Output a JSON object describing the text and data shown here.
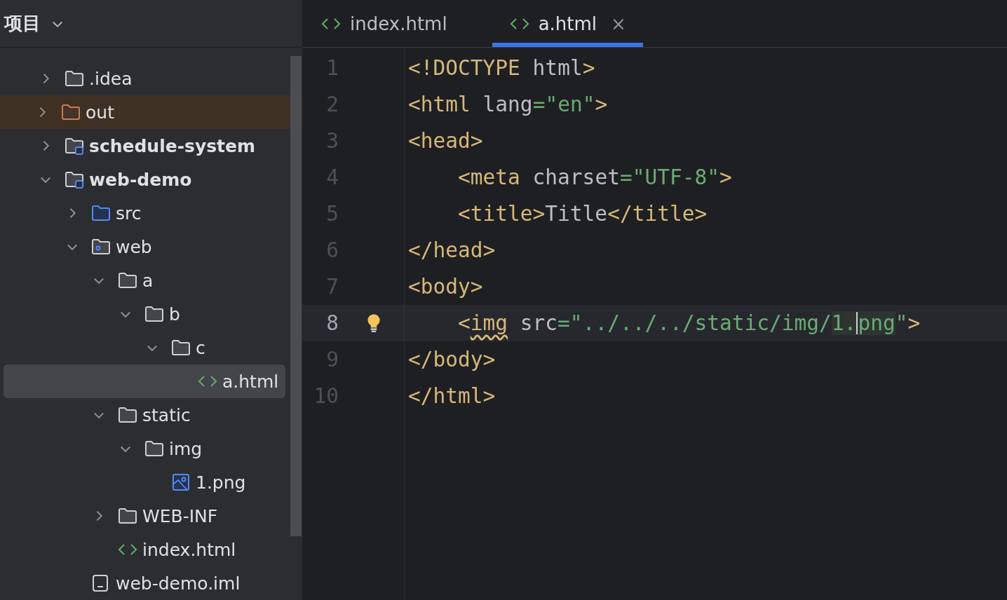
{
  "sidebar": {
    "title": "项目",
    "tree": [
      {
        "name": ".idea",
        "kind": "folder",
        "expanded": false,
        "selected": false
      },
      {
        "name": "out",
        "kind": "excluded",
        "expanded": false,
        "selected": false
      },
      {
        "name": "schedule-system",
        "kind": "module",
        "expanded": false,
        "selected": false
      },
      {
        "name": "web-demo",
        "kind": "module",
        "expanded": true,
        "selected": false,
        "children": [
          {
            "name": "src",
            "kind": "source",
            "expanded": false,
            "selected": false
          },
          {
            "name": "web",
            "kind": "webroot",
            "expanded": true,
            "selected": false,
            "children": [
              {
                "name": "a",
                "kind": "folder",
                "expanded": true,
                "selected": false,
                "children": [
                  {
                    "name": "b",
                    "kind": "folder",
                    "expanded": true,
                    "selected": false,
                    "children": [
                      {
                        "name": "c",
                        "kind": "folder",
                        "expanded": true,
                        "selected": false,
                        "children": [
                          {
                            "name": "a.html",
                            "kind": "html",
                            "selected": true
                          }
                        ]
                      }
                    ]
                  }
                ]
              },
              {
                "name": "static",
                "kind": "folder",
                "expanded": true,
                "selected": false,
                "children": [
                  {
                    "name": "img",
                    "kind": "folder",
                    "expanded": true,
                    "selected": false,
                    "children": [
                      {
                        "name": "1.png",
                        "kind": "image",
                        "selected": false
                      }
                    ]
                  }
                ]
              },
              {
                "name": "WEB-INF",
                "kind": "folder",
                "expanded": false,
                "selected": false
              },
              {
                "name": "index.html",
                "kind": "html",
                "selected": false
              }
            ]
          },
          {
            "name": "web-demo.iml",
            "kind": "iml",
            "selected": false
          }
        ]
      }
    ]
  },
  "tabs": [
    {
      "label": "index.html",
      "selected": false,
      "closable": false
    },
    {
      "label": "a.html",
      "selected": true,
      "closable": true,
      "close": "×"
    }
  ],
  "editor": {
    "lines": [
      {
        "number": "1",
        "current": false,
        "bulb": false,
        "indented": false,
        "tokens": [
          {
            "kind": "tag",
            "text": "<!DOCTYPE "
          },
          {
            "kind": "attr",
            "text": "html"
          },
          {
            "kind": "tag",
            "text": ">"
          }
        ]
      },
      {
        "number": "2",
        "current": false,
        "bulb": false,
        "indented": false,
        "tokens": [
          {
            "kind": "tag",
            "text": "<html "
          },
          {
            "kind": "attr",
            "text": "lang"
          },
          {
            "kind": "str",
            "text": "=\"en\""
          },
          {
            "kind": "tag",
            "text": ">"
          }
        ]
      },
      {
        "number": "3",
        "current": false,
        "bulb": false,
        "indented": false,
        "tokens": [
          {
            "kind": "tag",
            "text": "<head>"
          }
        ]
      },
      {
        "number": "4",
        "current": false,
        "bulb": false,
        "indented": true,
        "tokens": [
          {
            "kind": "tag",
            "text": "<meta "
          },
          {
            "kind": "attr",
            "text": "charset"
          },
          {
            "kind": "str",
            "text": "=\"UTF-8\""
          },
          {
            "kind": "tag",
            "text": ">"
          }
        ]
      },
      {
        "number": "5",
        "current": false,
        "bulb": false,
        "indented": true,
        "tokens": [
          {
            "kind": "tag",
            "text": "<title>"
          },
          {
            "kind": "text",
            "text": "Title"
          },
          {
            "kind": "tag",
            "text": "</title>"
          }
        ]
      },
      {
        "number": "6",
        "current": false,
        "bulb": false,
        "indented": false,
        "tokens": [
          {
            "kind": "tag",
            "text": "</head>"
          }
        ]
      },
      {
        "number": "7",
        "current": false,
        "bulb": false,
        "indented": false,
        "tokens": [
          {
            "kind": "tag",
            "text": "<body>"
          }
        ]
      },
      {
        "number": "8",
        "current": true,
        "bulb": true,
        "indented": true,
        "tokens": [
          {
            "kind": "tag",
            "text": "<"
          },
          {
            "kind": "warn",
            "text": "img"
          },
          {
            "kind": "attr",
            "text": " src"
          },
          {
            "kind": "str",
            "text": "=\"../../../static/img/"
          },
          {
            "kind": "strhl",
            "text": "1."
          },
          {
            "kind": "strhl",
            "text": "png",
            "caret_before": true
          },
          {
            "kind": "str",
            "text": "\""
          },
          {
            "kind": "tag",
            "text": ">"
          }
        ]
      },
      {
        "number": "9",
        "current": false,
        "bulb": false,
        "indented": false,
        "tokens": [
          {
            "kind": "tag",
            "text": "</body>"
          }
        ]
      },
      {
        "number": "10",
        "current": false,
        "bulb": false,
        "indented": false,
        "tokens": [
          {
            "kind": "tag",
            "text": "</html>"
          }
        ]
      }
    ]
  }
}
